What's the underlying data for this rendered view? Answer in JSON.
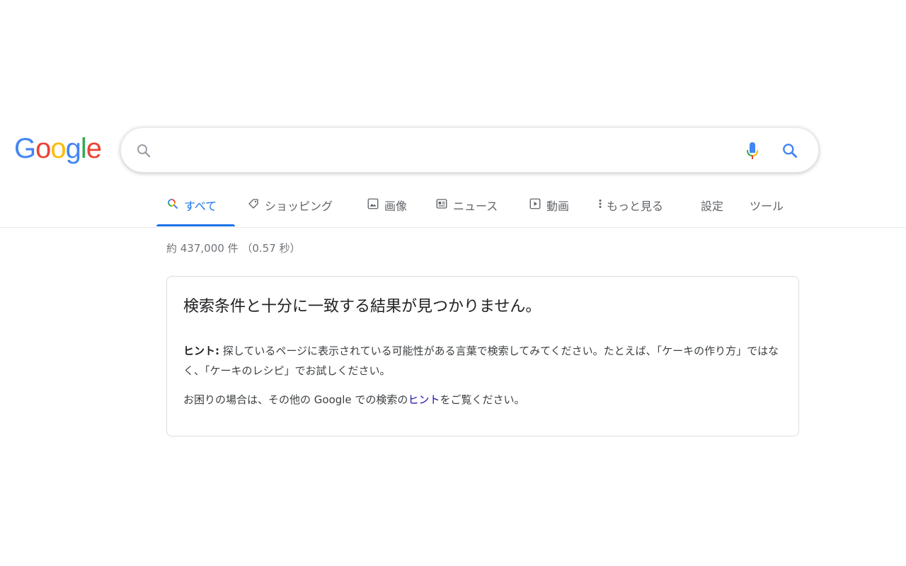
{
  "logo": {
    "letters": [
      {
        "char": "G",
        "color": "#4285F4"
      },
      {
        "char": "o",
        "color": "#EA4335"
      },
      {
        "char": "o",
        "color": "#FBBC05"
      },
      {
        "char": "g",
        "color": "#4285F4"
      },
      {
        "char": "l",
        "color": "#34A853"
      },
      {
        "char": "e",
        "color": "#EA4335"
      }
    ]
  },
  "search": {
    "value": "",
    "left_icon": "search-icon",
    "mic_icon": "microphone-icon",
    "right_icon": "search-icon"
  },
  "tabs": [
    {
      "label": "すべて",
      "icon": "search-icon",
      "active": true
    },
    {
      "label": "ショッピング",
      "icon": "tag-icon"
    },
    {
      "label": "画像",
      "icon": "image-icon"
    },
    {
      "label": "ニュース",
      "icon": "news-icon"
    },
    {
      "label": "動画",
      "icon": "play-icon"
    },
    {
      "label": "もっと見る",
      "icon": "more-vert-icon"
    },
    {
      "label": "設定"
    },
    {
      "label": "ツール"
    }
  ],
  "stats": "約 437,000 件 （0.57 秒）",
  "no_results": {
    "title": "検索条件と十分に一致する結果が見つかりません。",
    "hint_label": "ヒント:",
    "hint_text": " 探しているページに表示されている可能性がある言葉で検索してみてください。たとえば、「ケーキの作り方」ではなく、「ケーキのレシピ」でお試しください。",
    "help_prefix": "お困りの場合は、その他の Google での検索の",
    "help_link": "ヒント",
    "help_suffix": "をご覧ください。"
  },
  "colors": {
    "accent": "#1a73e8",
    "link": "#1a0dab",
    "muted": "#70757a"
  }
}
